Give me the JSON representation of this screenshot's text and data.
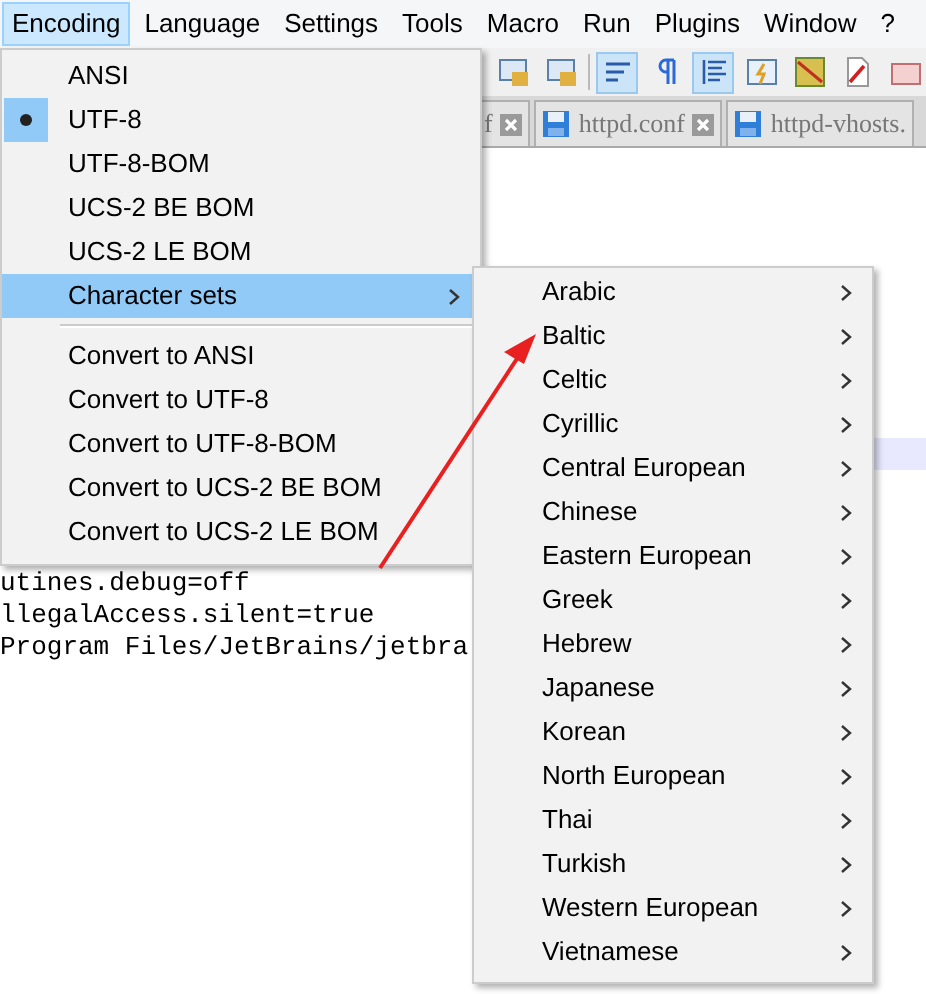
{
  "menubar": [
    {
      "label": "Encoding",
      "selected": true
    },
    {
      "label": "Language",
      "selected": false
    },
    {
      "label": "Settings",
      "selected": false
    },
    {
      "label": "Tools",
      "selected": false
    },
    {
      "label": "Macro",
      "selected": false
    },
    {
      "label": "Run",
      "selected": false
    },
    {
      "label": "Plugins",
      "selected": false
    },
    {
      "label": "Window",
      "selected": false
    },
    {
      "label": "?",
      "selected": false
    }
  ],
  "tabs": [
    {
      "label": "f"
    },
    {
      "label": "httpd.conf"
    },
    {
      "label": "httpd-vhosts."
    }
  ],
  "editor_lines": [
    "utines.debug=off",
    "llegalAccess.silent=true",
    "Program Files/JetBrains/jetbra"
  ],
  "encoding_menu": [
    {
      "kind": "radio",
      "label": "ANSI",
      "checked": false,
      "highlighted": false
    },
    {
      "kind": "radio",
      "label": "UTF-8",
      "checked": true,
      "highlighted": false
    },
    {
      "kind": "radio",
      "label": "UTF-8-BOM",
      "checked": false,
      "highlighted": false
    },
    {
      "kind": "radio",
      "label": "UCS-2 BE BOM",
      "checked": false,
      "highlighted": false
    },
    {
      "kind": "radio",
      "label": "UCS-2 LE BOM",
      "checked": false,
      "highlighted": false
    },
    {
      "kind": "submenu",
      "label": "Character sets",
      "highlighted": true
    },
    {
      "kind": "separator"
    },
    {
      "kind": "command",
      "label": "Convert to ANSI",
      "highlighted": false
    },
    {
      "kind": "command",
      "label": "Convert to UTF-8",
      "highlighted": false
    },
    {
      "kind": "command",
      "label": "Convert to UTF-8-BOM",
      "highlighted": false
    },
    {
      "kind": "command",
      "label": "Convert to UCS-2 BE BOM",
      "highlighted": false
    },
    {
      "kind": "command",
      "label": "Convert to UCS-2 LE BOM",
      "highlighted": false
    }
  ],
  "character_sets_menu": [
    "Arabic",
    "Baltic",
    "Celtic",
    "Cyrillic",
    "Central European",
    "Chinese",
    "Eastern European",
    "Greek",
    "Hebrew",
    "Japanese",
    "Korean",
    "North European",
    "Thai",
    "Turkish",
    "Western European",
    "Vietnamese"
  ]
}
